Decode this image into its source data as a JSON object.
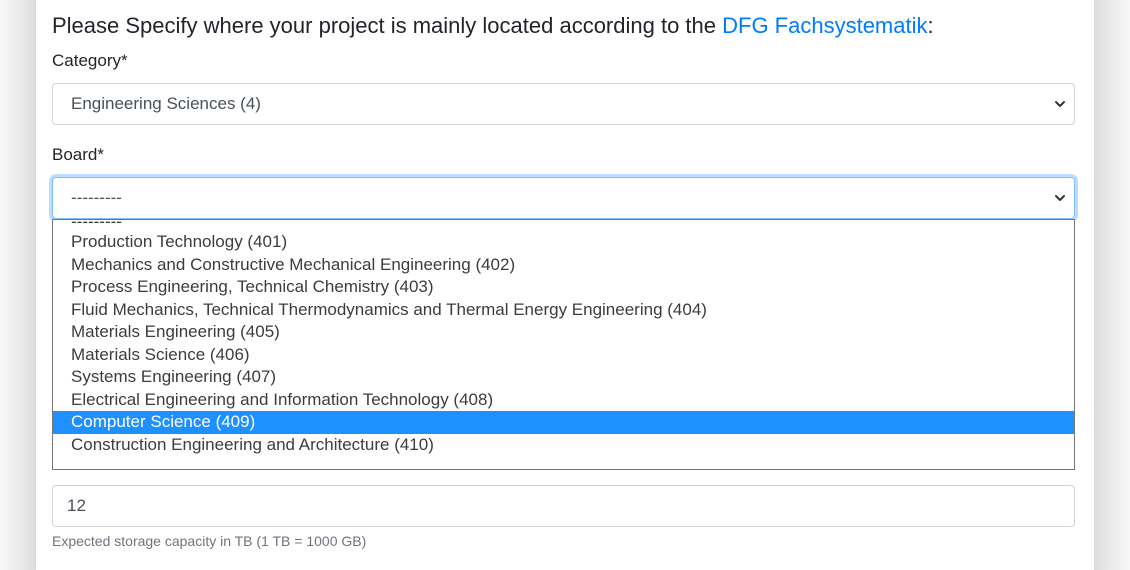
{
  "heading": {
    "prefix": "Please Specify where your project is mainly located according to the ",
    "link": "DFG Fachsystematik",
    "suffix": ":"
  },
  "category": {
    "label": "Category*",
    "value": "Engineering Sciences (4)"
  },
  "board": {
    "label": "Board*",
    "value": "---------",
    "options": [
      "---------",
      "Production Technology (401)",
      "Mechanics and Constructive Mechanical Engineering (402)",
      "Process Engineering, Technical Chemistry (403)",
      "Fluid Mechanics, Technical Thermodynamics and Thermal Energy Engineering (404)",
      "Materials Engineering (405)",
      "Materials Science (406)",
      "Systems Engineering (407)",
      "Electrical Engineering and Information Technology (408)",
      "Computer Science (409)",
      "Construction Engineering and Architecture (410)"
    ],
    "highlighted": "Computer Science (409)"
  },
  "capacity": {
    "value": "12",
    "help": "Expected storage capacity in TB (1 TB = 1000 GB)"
  },
  "colors": {
    "link": "#007bff",
    "highlight": "#1e90ff",
    "focus_border": "#80bdff"
  },
  "icons": {
    "select_arrow": "chevron-down-icon"
  }
}
